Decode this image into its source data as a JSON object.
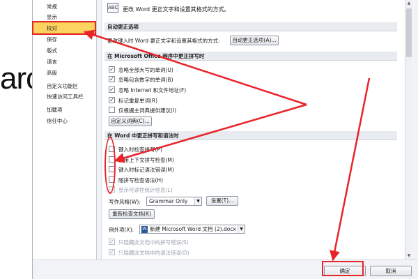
{
  "background": {
    "partial_text": "arc"
  },
  "nav": {
    "items": [
      {
        "label": "常规"
      },
      {
        "label": "显示"
      },
      {
        "label": "校对"
      },
      {
        "label": "保存"
      },
      {
        "label": "版式"
      },
      {
        "label": "语言"
      },
      {
        "label": "高级"
      },
      {
        "label": "自定义功能区"
      },
      {
        "label": "快速访问工具栏"
      },
      {
        "label": "加载项"
      },
      {
        "label": "信任中心"
      }
    ],
    "selected": "校对"
  },
  "header": {
    "icon_text": "ABC",
    "text": "更改 Word 更正文字和设置其格式的方式。"
  },
  "autocorrect": {
    "title": "自动更正选项",
    "description": "更改键入时 Word 更正文字和设置其格式的方式:",
    "button": "自动更正选项(A)..."
  },
  "office_spelling": {
    "title": "在 Microsoft Office 程序中更正拼写时",
    "options": [
      {
        "label": "忽略全部大写的单词(U)",
        "checked": true
      },
      {
        "label": "忽略包含数字的单词(B)",
        "checked": true
      },
      {
        "label": "忽略 Internet 和文件地址(F)",
        "checked": true
      },
      {
        "label": "标记重复单词(R)",
        "checked": true
      },
      {
        "label": "仅根据主词典提供建议(I)",
        "checked": false
      }
    ],
    "custom_dict_button": "自定义词典(C)..."
  },
  "word_spelling": {
    "title": "在 Word 中更正拼写和语法时",
    "options": [
      {
        "label": "键入时检查拼写(P)",
        "checked": false
      },
      {
        "label": "使用上下文拼写检查(M)",
        "checked": false
      },
      {
        "label": "键入时标记语法错误(M)",
        "checked": false
      },
      {
        "label": "随拼写检查语法(H)",
        "checked": false
      },
      {
        "label": "显示可读性统计信息(L)",
        "checked": false
      }
    ],
    "writing_style_label": "写作风格(W):",
    "writing_style_value": "Grammar Only",
    "settings_button": "设置(T)...",
    "recheck_button": "重新检查文档(K)"
  },
  "exceptions": {
    "label": "例外项(X):",
    "doc_value": "新建 Microsoft Word 文档 (2).docx",
    "options": [
      {
        "label": "只隐藏此文档中的拼写错误(S)",
        "checked": true
      },
      {
        "label": "只隐藏此文档中的语法错误(D)",
        "checked": true
      }
    ]
  },
  "footer": {
    "ok": "确定",
    "cancel": "取消"
  },
  "colors": {
    "selected_nav": "#fbd35e",
    "annotation_red": "#e8232a"
  }
}
